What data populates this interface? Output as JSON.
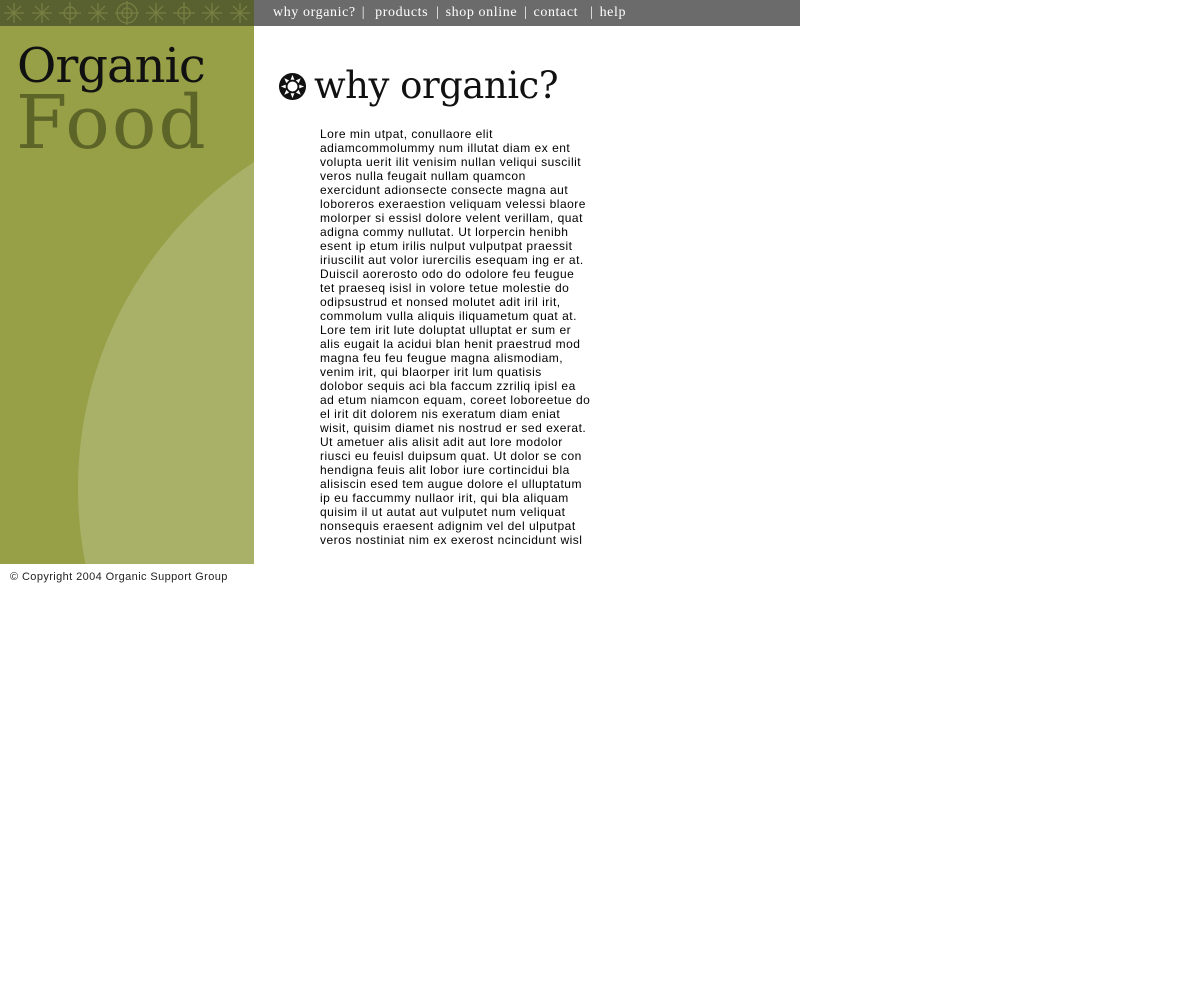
{
  "nav": {
    "items": [
      {
        "label": "why organic?"
      },
      {
        "label": "products"
      },
      {
        "label": "shop online"
      },
      {
        "label": "contact"
      },
      {
        "label": "help"
      }
    ],
    "separator": "|"
  },
  "logo": {
    "line1": "Organic",
    "line2": "Food"
  },
  "main": {
    "heading": "why organic?",
    "body_lines": [
      "Lore min utpat, conullaore elit",
      "adiamcommolummy num illutat diam ex ent",
      "volupta uerit ilit venisim nullan veliqui suscilit",
      "veros nulla feugait nullam quamcon",
      "exercidunt adionsecte consecte magna aut",
      "loboreros exeraestion veliquam velessi blaore",
      "molorper si essisl dolore velent verillam, quat",
      "adigna commy nullutat. Ut lorpercin henibh",
      "esent ip etum irilis nulput vulputpat praessit",
      "iriuscilit aut volor iurercilis esequam ing er at.",
      "Duiscil aorerosto odo do odolore feu feugue",
      "tet praeseq isisl in volore tetue molestie do",
      "odipsustrud et nonsed molutet adit iril irit,",
      "commolum vulla aliquis iliquametum quat at.",
      "Lore tem irit lute doluptat ulluptat er sum er",
      "alis eugait la acidui blan henit praestrud mod",
      "magna feu feu feugue magna alismodiam,",
      "venim irit, qui blaorper irit lum quatisis",
      "dolobor sequis aci bla faccum zzriliq ipisl ea",
      "ad etum niamcon equam, coreet loboreetue do",
      "el irit dit dolorem nis exeratum diam eniat",
      "wisit, quisim diamet nis nostrud er sed exerat.",
      "Ut ametuer alis alisit adit aut lore modolor",
      "riusci eu feuisl duipsum quat. Ut dolor se con",
      "hendigna feuis alit lobor iure cortincidui bla",
      "alisiscin esed tem augue dolore el ulluptatum",
      "ip eu faccummy nullaor irit, qui bla aliquam",
      "quisim il ut autat aut vulputet num veliquat",
      "nonsequis eraesent adignim vel del ulputpat",
      "veros nostiniat nim ex exerost ncincidunt wisl"
    ]
  },
  "footer": {
    "copyright": "© Copyright 2004 Organic Support Group"
  },
  "colors": {
    "nav_bg": "#6b6b6b",
    "panel_green": "#97a046",
    "panel_arc": "#a9b068",
    "food_text": "#5d6428",
    "strip_bg": "#5a6130"
  },
  "icons": {
    "heading": "sun-flower-icon",
    "strip": "flower-pattern"
  }
}
